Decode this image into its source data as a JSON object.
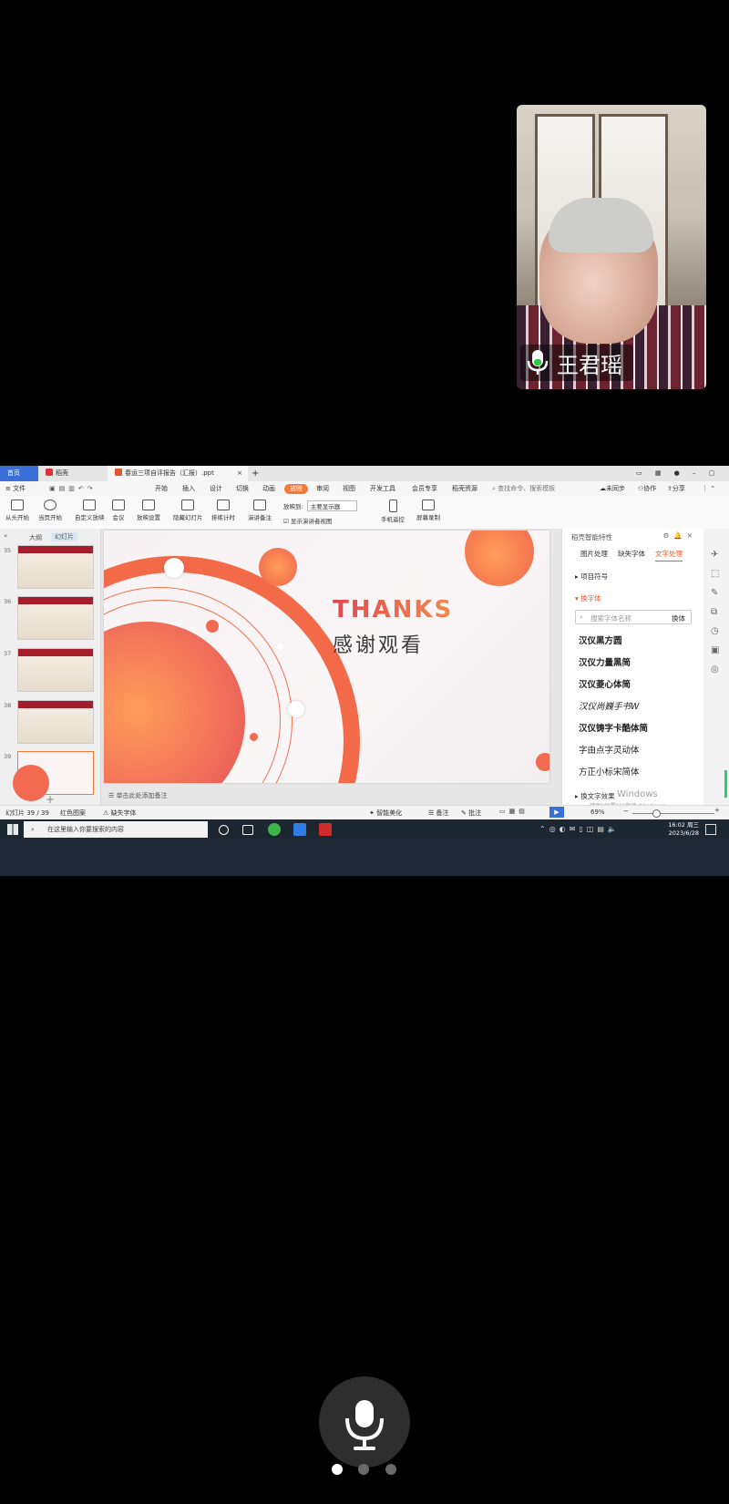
{
  "participant": {
    "name": "王君瑶"
  },
  "wps": {
    "tabs": [
      "首页",
      "稻壳",
      "春运三项自评报告（汇报）.ppt"
    ],
    "menu": [
      "文件",
      "开始",
      "插入",
      "设计",
      "切换",
      "动画",
      "放映",
      "审阅",
      "视图",
      "开发工具",
      "会员专享",
      "稻壳资源"
    ],
    "active_menu": "放映",
    "search_placeholder": "查找命令、搜索模板",
    "top_right": [
      "未同步",
      "协作",
      "分享"
    ],
    "ribbon": [
      "从头开始",
      "当页开始",
      "自定义放映",
      "会议",
      "放映设置",
      "隐藏幻灯片",
      "排练计时",
      "演讲备注",
      "手机遥控",
      "屏幕录制"
    ],
    "display_label": "放映到:",
    "display_value": "主要显示器",
    "presenter_checkbox": "显示演讲者视图",
    "panel_tabs": [
      "大纲",
      "幻灯片"
    ],
    "thumb_numbers": [
      "35",
      "36",
      "37",
      "38",
      "39"
    ],
    "slide": {
      "title": "THANKS",
      "subtitle": "感谢观看"
    },
    "notes_placeholder": "单击此处添加备注",
    "side_panel": {
      "title": "稻壳智能特性",
      "tabs": [
        "图片处理",
        "缺失字体",
        "文字处理"
      ],
      "section1": "项目符号",
      "section2": "换字体",
      "search_placeholder": "搜索字体名称",
      "search_btn": "换体",
      "fonts": [
        "汉仪黑方圆",
        "汉仪力量黑简",
        "汉仪菱心体简",
        "汉仪尚巍手书W",
        "汉仪铸字卡酷体简",
        "字由点字灵动体",
        "方正小标宋简体"
      ],
      "section3": "换文字效果",
      "watermark_line1": "Windows",
      "watermark_line2": "转到\"设置\"以激活 Windows。"
    },
    "status": {
      "slide_count": "幻灯片 39 / 39",
      "theme": "红色图案",
      "missing_font": "缺失字体",
      "beautify": "智能美化",
      "notes": "备注",
      "comments": "批注",
      "zoom": "69%"
    }
  },
  "taskbar": {
    "search_placeholder": "在这里输入你要搜索的内容",
    "time": "16:02 周三",
    "date": "2023/6/28"
  },
  "colors": {
    "accent_orange": "#f47a4a",
    "accent_red": "#e3454f",
    "wps_red": "#c0392b"
  }
}
